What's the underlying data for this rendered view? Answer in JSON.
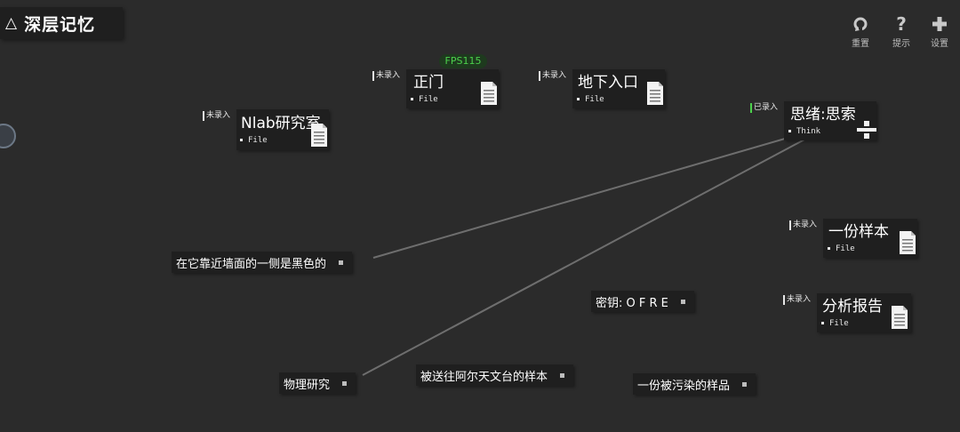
{
  "title": {
    "icon": "triangle-icon",
    "text": "深层记忆"
  },
  "toolbar": {
    "reset_label": "重置",
    "hint_label": "提示",
    "settings_label": "设置"
  },
  "fps": "FPS115",
  "nodes": {
    "nlab": {
      "status": "未录入",
      "name": "Nlab研究室",
      "type": "File"
    },
    "front_door": {
      "status": "未录入",
      "name": "正门",
      "type": "File"
    },
    "underground": {
      "status": "未录入",
      "name": "地下入口",
      "type": "File"
    },
    "thought": {
      "status": "已录入",
      "name": "思绪:思索",
      "type": "Think"
    },
    "sample": {
      "status": "未录入",
      "name": "一份样本",
      "type": "File"
    },
    "report": {
      "status": "未录入",
      "name": "分析报告",
      "type": "File"
    }
  },
  "clues": {
    "wall": "在它靠近墙面的一侧是黑色的",
    "key": "密钥: O F R E",
    "physics": "物理研究",
    "sent_sample": "被送往阿尔天文台的样本",
    "polluted": "一份被污染的样品"
  },
  "colors": {
    "background": "#2b2b2b",
    "panel": "#1f1f1f",
    "recorded": "#4cd14c",
    "link": "#6e6e6e"
  }
}
